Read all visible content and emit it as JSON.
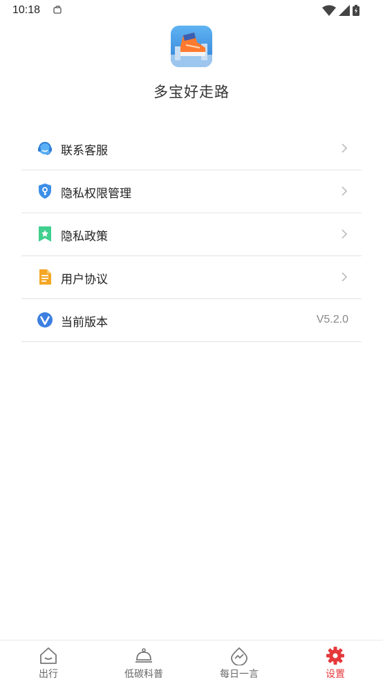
{
  "status_bar": {
    "time": "10:18"
  },
  "app": {
    "name": "多宝好走路"
  },
  "menu": [
    {
      "label": "联系客服",
      "icon": "customer-service-icon",
      "has_chevron": true
    },
    {
      "label": "隐私权限管理",
      "icon": "privacy-shield-icon",
      "has_chevron": true
    },
    {
      "label": "隐私政策",
      "icon": "bookmark-star-icon",
      "has_chevron": true
    },
    {
      "label": "用户协议",
      "icon": "document-icon",
      "has_chevron": true
    },
    {
      "label": "当前版本",
      "icon": "version-v-icon",
      "value": "V5.2.0"
    }
  ],
  "bottom_nav": [
    {
      "label": "出行",
      "icon": "house-icon"
    },
    {
      "label": "低碳科普",
      "icon": "dish-cover-icon"
    },
    {
      "label": "每日一言",
      "icon": "chart-drop-icon"
    },
    {
      "label": "设置",
      "icon": "gear-icon",
      "active": true
    }
  ],
  "colors": {
    "accent": "#e5383b",
    "divider": "#e3e3e3"
  }
}
